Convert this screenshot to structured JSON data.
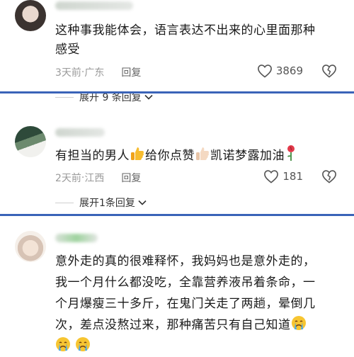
{
  "comments": [
    {
      "text_line1": "这种事我能体会，语言表达不出来的心里面那种",
      "text_line2": "感受",
      "time": "3天前",
      "location": "广东",
      "reply_label": "回复",
      "like_count": "3869",
      "expand_label": "展开 9 条回复"
    },
    {
      "text_parts": [
        "有担当的男人",
        "给你点赞",
        "凯诺梦露加油"
      ],
      "time": "2天前",
      "location": "江西",
      "reply_label": "回复",
      "like_count": "181",
      "expand_label": "展开1条回复"
    },
    {
      "text_lines": [
        "意外走的真的很难释怀，我妈妈也是意外走的，",
        "我一个月什么都没吃，全靠营养液吊着条命，一",
        "个月爆瘦三十多斤，在鬼门关走了两趟，晕倒几",
        "次，差点没熬过来，那种痛苦只有自己知道"
      ]
    }
  ],
  "colors": {
    "divider": "#3a63b8",
    "meta": "#9a9a9a",
    "text": "#1a1a1a"
  },
  "icons": [
    "heart-outline-icon",
    "dislike-heart-icon",
    "chevron-down-icon",
    "thumbs-up-emoji",
    "rose-emoji",
    "crying-emoji"
  ]
}
